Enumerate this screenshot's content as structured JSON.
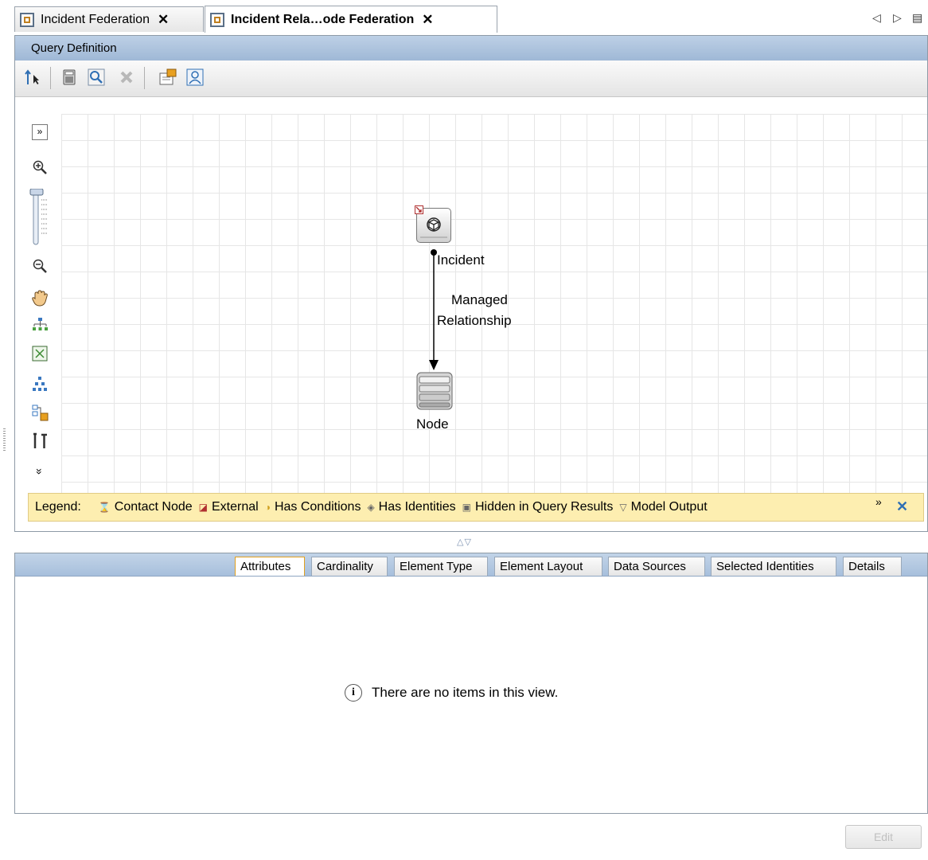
{
  "tabs": [
    {
      "label": "Incident Federation",
      "close": "✕"
    },
    {
      "label": "Incident Rela…ode Federation",
      "close": "✕"
    }
  ],
  "tab_nav": {
    "left": "◁",
    "right": "▷",
    "menu": "▤"
  },
  "panel": {
    "title": "Query Definition"
  },
  "toolbar": {
    "icons": [
      "select-pointer-icon",
      "calculator-icon",
      "search-icon",
      "delete-icon",
      "properties-icon",
      "user-icon"
    ]
  },
  "side_tools": {
    "expand": "»",
    "collapse": "»"
  },
  "diagram": {
    "nodes": [
      {
        "label": "Incident",
        "icon": "cube-icon"
      },
      {
        "label": "Node",
        "icon": "database-icon"
      }
    ],
    "relationship": {
      "label_line1": "Managed",
      "label_line2": "Relationship"
    }
  },
  "legend": {
    "title": "Legend:",
    "items": [
      {
        "icon": "contact-node-icon",
        "glyph": "⌛",
        "label": "Contact Node"
      },
      {
        "icon": "external-icon",
        "glyph": "◪",
        "label": "External"
      },
      {
        "icon": "has-conditions-icon",
        "glyph": "◑",
        "label": "Has Conditions"
      },
      {
        "icon": "has-identities-icon",
        "glyph": "◈",
        "label": "Has Identities"
      },
      {
        "icon": "hidden-in-query-results-icon",
        "glyph": "▣",
        "label": "Hidden in Query Results"
      },
      {
        "icon": "model-output-icon",
        "glyph": "▽",
        "label": "Model Output"
      }
    ],
    "more": "»",
    "close": "✕"
  },
  "splitter": {
    "arrows": "△▽"
  },
  "bottom_tabs": [
    {
      "label": "Attributes",
      "active": true
    },
    {
      "label": "Cardinality",
      "active": false
    },
    {
      "label": "Element Type",
      "active": false
    },
    {
      "label": "Element Layout",
      "active": false
    },
    {
      "label": "Data Sources",
      "active": false
    },
    {
      "label": "Selected Identities",
      "active": false
    },
    {
      "label": "Details",
      "active": false
    }
  ],
  "empty_state": {
    "icon": "info-icon",
    "glyph": "i",
    "message": "There are no items in this view."
  },
  "edit_button": {
    "label": "Edit",
    "enabled": false
  },
  "colors": {
    "title_bar": "#9fb8d6",
    "legend_bg": "#fdeeb0",
    "active_tab_border": "#e0a020"
  }
}
